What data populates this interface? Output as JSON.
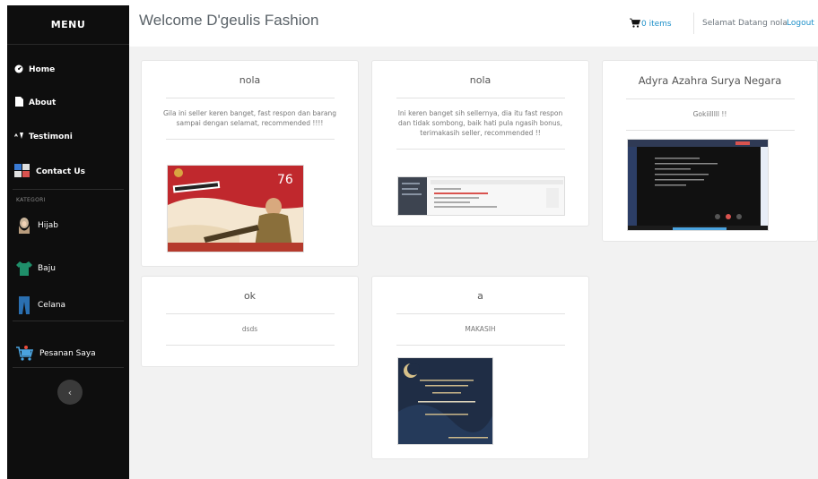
{
  "sidebar": {
    "title": "MENU",
    "nav": [
      {
        "label": "Home",
        "icon": "dashboard-icon"
      },
      {
        "label": "About",
        "icon": "file-icon"
      },
      {
        "label": "Testimoni",
        "icon": "testimoni-icon"
      },
      {
        "label": "Contact Us",
        "icon": "contact-icon"
      }
    ],
    "category_heading": "KATEGORI",
    "categories": [
      {
        "label": "Hijab",
        "icon": "hijab-icon"
      },
      {
        "label": "Baju",
        "icon": "shirt-icon"
      },
      {
        "label": "Celana",
        "icon": "pants-icon"
      }
    ],
    "orders": {
      "label": "Pesanan Saya",
      "icon": "shopping-cart-icon"
    },
    "collapse_icon": "chevron-left-icon"
  },
  "header": {
    "brand": "Welcome D'geulis Fashion",
    "cart_count": "0 items",
    "greeting": "Selamat Datang nola",
    "logout": "Logout"
  },
  "testimonials": [
    {
      "name": "nola",
      "text": "Gila ini seller keren banget, fast respon dan barang sampai dengan selamat, recommended !!!!",
      "image": "merdeka-poster"
    },
    {
      "name": "nola",
      "text": "Ini keren banget sih sellernya, dia itu fast respon dan tidak sombong, baik hati pula ngasih bonus, terimakasih seller, recommended !!",
      "image": "app-screenshot"
    },
    {
      "name": "Adyra Azahra Surya Negara",
      "text": "Gokiilllll !!",
      "image": "terminal-screenshot"
    },
    {
      "name": "ok",
      "text": "dsds",
      "image": ""
    },
    {
      "name": "a",
      "text": "MAKASIH",
      "image": "eid-greeting-card"
    }
  ],
  "colors": {
    "sidebar_bg": "#0e0e0e",
    "link": "#1e90c9",
    "content_bg": "#f2f2f2"
  }
}
